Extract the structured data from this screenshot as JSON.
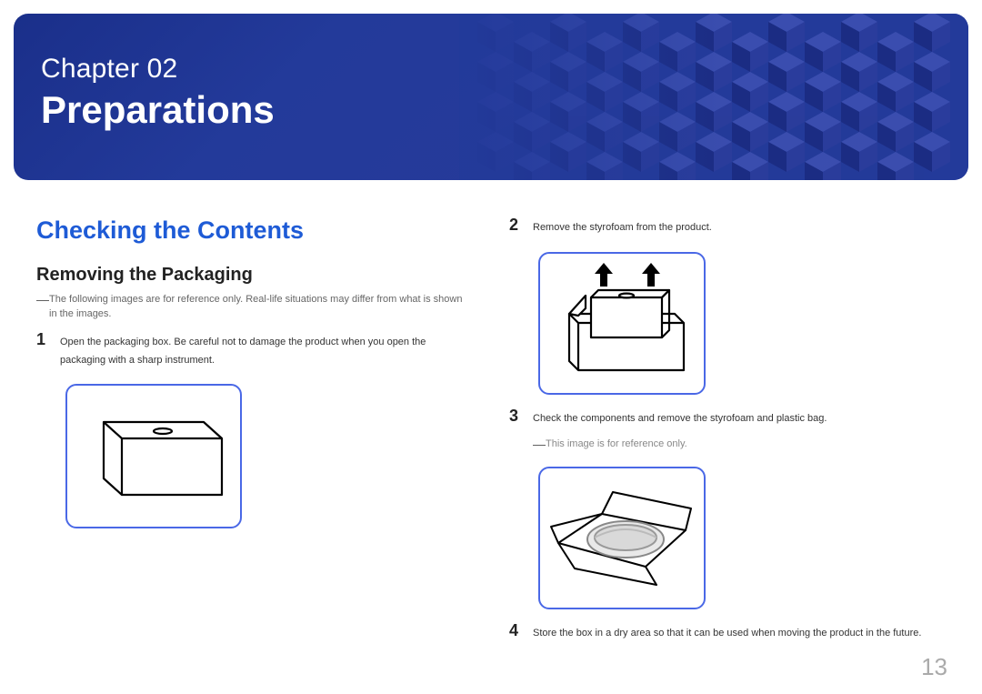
{
  "banner": {
    "chapter_label": "Chapter  02",
    "chapter_title": "Preparations"
  },
  "section": {
    "heading": "Checking the Contents",
    "sub_heading": "Removing the Packaging",
    "note_images": "The following images are for reference only. Real-life situations may differ from what is shown in the images.",
    "step1": "Open the packaging box. Be careful not to damage the product when you open the packaging with a sharp instrument.",
    "step2": "Remove the styrofoam from the product.",
    "step3": "Check the components and remove the styrofoam and plastic bag.",
    "note_ref": "This image is for reference only.",
    "step4": "Store the box in a dry area so that it can be used when moving the product in the future."
  },
  "step_numbers": {
    "s1": "1",
    "s2": "2",
    "s3": "3",
    "s4": "4"
  },
  "page_number": "13",
  "colors": {
    "accent": "#1e5bd6",
    "figure_border": "#4a68e6",
    "banner_bg": "#233a9a"
  }
}
